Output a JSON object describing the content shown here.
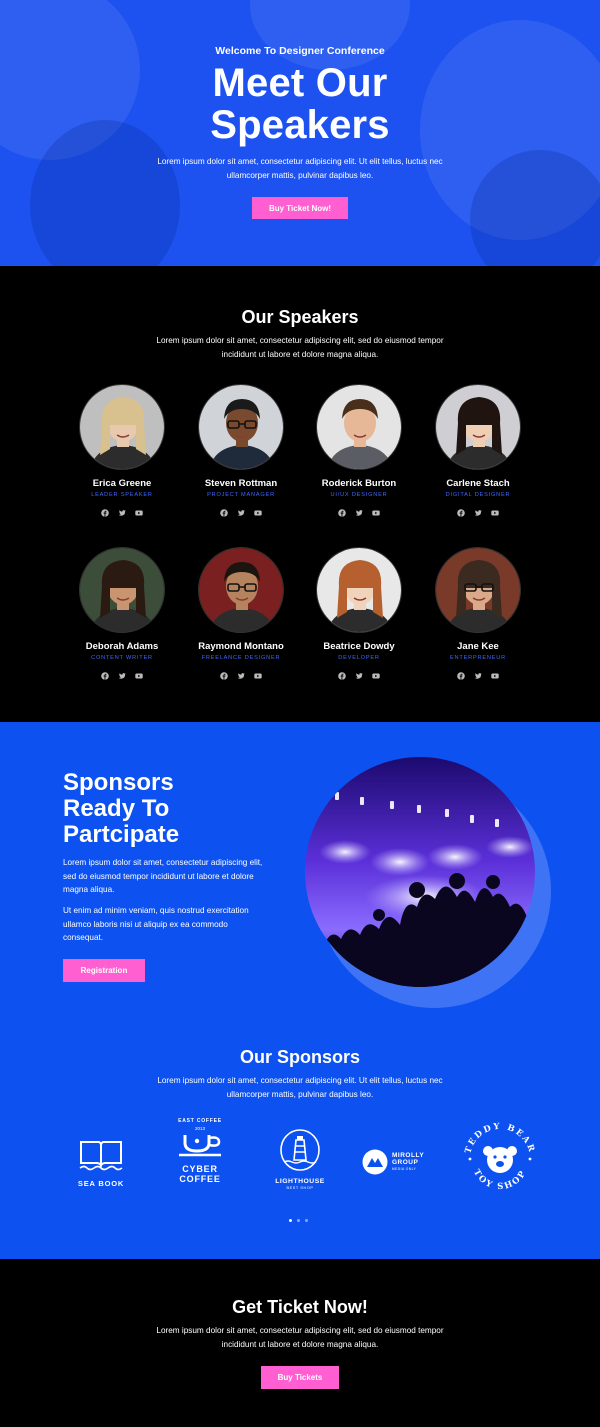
{
  "hero": {
    "kicker": "Welcome To Designer Conference",
    "title_line1": "Meet Our",
    "title_line2": "Speakers",
    "description": "Lorem ipsum dolor sit amet, consectetur adipiscing elit. Ut elit tellus, luctus nec ullamcorper mattis, pulvinar dapibus leo.",
    "cta": "Buy Ticket Now!"
  },
  "speakers_section": {
    "title": "Our Speakers",
    "description": "Lorem ipsum dolor sit amet, consectetur adipiscing elit, sed do eiusmod tempor incididunt ut labore et dolore magna aliqua.",
    "speakers": [
      {
        "name": "Erica Greene",
        "role": "Leader Speaker"
      },
      {
        "name": "Steven Rottman",
        "role": "Project Manager"
      },
      {
        "name": "Roderick Burton",
        "role": "UI/UX Designer"
      },
      {
        "name": "Carlene Stach",
        "role": "Digital Designer"
      },
      {
        "name": "Deborah Adams",
        "role": "Content Writer"
      },
      {
        "name": "Raymond Montano",
        "role": "Freelance Designer"
      },
      {
        "name": "Beatrice Dowdy",
        "role": "Developer"
      },
      {
        "name": "Jane Kee",
        "role": "Enterpreneur"
      }
    ],
    "social_icons": [
      "facebook-icon",
      "twitter-icon",
      "youtube-icon"
    ]
  },
  "sponsors_ready": {
    "title_line1": "Sponsors",
    "title_line2": "Ready To",
    "title_line3": "Partcipate",
    "paragraph1": "Lorem ipsum dolor sit amet, consectetur adipiscing elit, sed do eiusmod tempor incididunt ut labore et dolore magna aliqua.",
    "paragraph2": "Ut enim ad minim veniam, quis nostrud exercitation ullamco laboris nisi ut aliquip ex ea commodo consequat.",
    "cta": "Registration"
  },
  "our_sponsors": {
    "title": "Our Sponsors",
    "description": "Lorem ipsum dolor sit amet, consectetur adipiscing elit. Ut elit tellus, luctus nec ullamcorper mattis, pulvinar dapibus leo.",
    "logos": {
      "seabook": "SEA BOOK",
      "cyber_top": "EAST COFFEE",
      "cyber_year": "2013",
      "cyber_line1": "CYBER",
      "cyber_line2": "COFFEE",
      "lighthouse": "LIGHTHOUSE",
      "lighthouse_sub": "BEST SHOP",
      "mirolly_line1": "MIROLLY",
      "mirolly_line2": "GROUP",
      "mirolly_sub": "MEDIA ONLY",
      "teddy_top": "TEDDY BEAR",
      "teddy_bottom": "TOY SHOP"
    }
  },
  "ticket": {
    "title": "Get Ticket Now!",
    "description": "Lorem ipsum dolor sit amet, consectetur adipiscing elit, sed do eiusmod tempor incididunt ut labore et dolore magna aliqua.",
    "cta": "Buy Tickets"
  },
  "colors": {
    "brand_blue": "#0d52f0",
    "accent_pink": "#ff5fd0",
    "role_blue": "#3d68ff"
  }
}
